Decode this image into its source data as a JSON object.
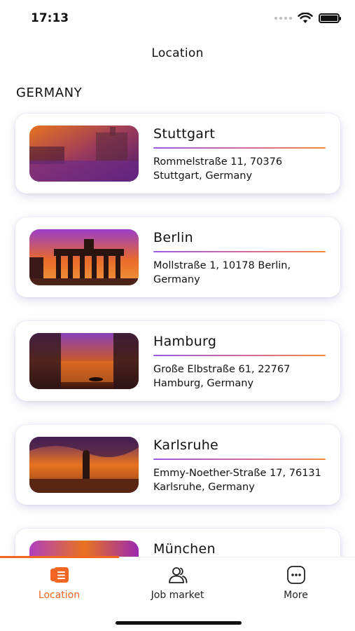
{
  "status_bar": {
    "time": "17:13"
  },
  "header": {
    "title": "Location"
  },
  "section": {
    "title": "GERMANY"
  },
  "locations": [
    {
      "city": "Stuttgart",
      "address": "Rommelstraße 11, 70376 Stuttgart, Germany"
    },
    {
      "city": "Berlin",
      "address": "Mollstraße 1, 10178 Berlin, Germany"
    },
    {
      "city": "Hamburg",
      "address": "Große Elbstraße 61, 22767 Hamburg, Germany"
    },
    {
      "city": "Karlsruhe",
      "address": "Emmy-Noether-Straße 17, 76131 Karlsruhe, Germany"
    },
    {
      "city": "München",
      "address": ""
    }
  ],
  "tab_bar": {
    "tabs": [
      {
        "label": "Location",
        "icon": "location-list-icon",
        "active": true
      },
      {
        "label": "Job market",
        "icon": "people-icon",
        "active": false
      },
      {
        "label": "More",
        "icon": "more-icon",
        "active": false
      }
    ]
  },
  "colors": {
    "accent": "#f26522",
    "gradient_start": "#9b59e0",
    "gradient_end": "#f28a3a"
  }
}
